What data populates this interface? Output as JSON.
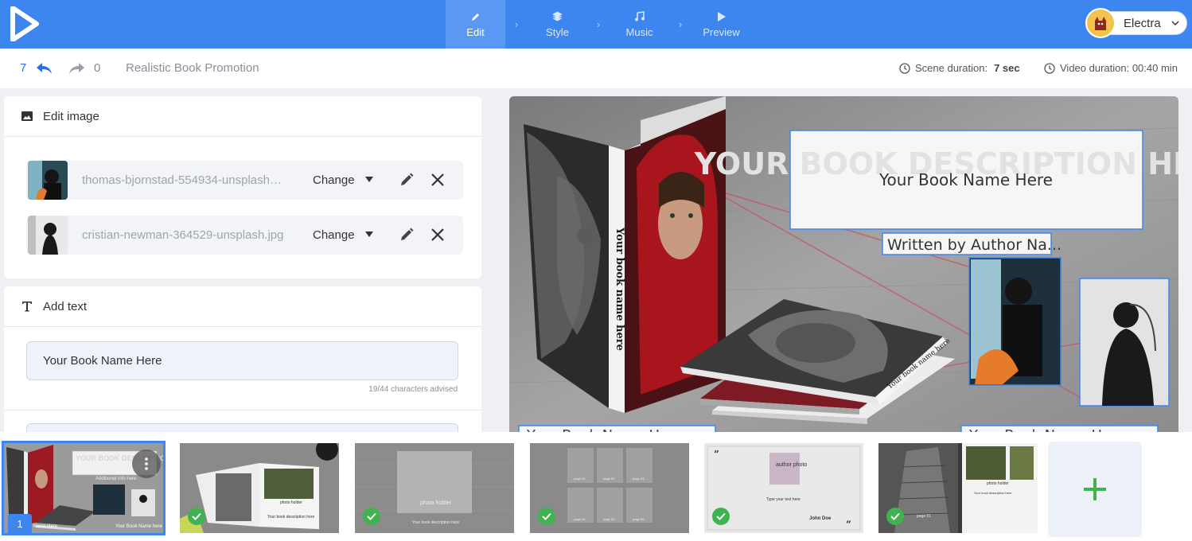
{
  "nav": {
    "steps": [
      {
        "label": "Edit",
        "icon": "pencil-icon",
        "active": true
      },
      {
        "label": "Style",
        "icon": "layers-icon",
        "active": false
      },
      {
        "label": "Music",
        "icon": "music-note-icon",
        "active": false
      },
      {
        "label": "Preview",
        "icon": "play-icon",
        "active": false
      }
    ],
    "user_name": "Electra"
  },
  "toolbar": {
    "undo_count": "7",
    "redo_count": "0",
    "project_title": "Realistic Book Promotion",
    "scene_duration_label": "Scene duration:",
    "scene_duration_value": "7 sec",
    "video_duration": "Video duration: 00:40 min"
  },
  "edit_image": {
    "title": "Edit image",
    "images": [
      {
        "name": "thomas-bjornstad-554934-unsplash.jpg",
        "change_label": "Change"
      },
      {
        "name": "cristian-newman-364529-unsplash.jpg",
        "change_label": "Change"
      }
    ]
  },
  "add_text": {
    "title": "Add text",
    "field_value": "Your Book Name Here",
    "char_hint": "19/44 characters advised"
  },
  "preview": {
    "description_text": "YOUR BOOK DESCRIPTION HERE",
    "book_name": "Your Book Name Here",
    "author": "Written by Author Na...",
    "spine_text": "Your book name here",
    "spine_text_2": "Your book name here",
    "bottom_left_name": "Your Book Name Here",
    "bottom_right_name": "Your Book Name Here"
  },
  "timeline": {
    "scene_1": {
      "number": "1",
      "description": "YOUR BOOK DESCRIPTION HERE",
      "info": "Additional info here",
      "name_left": "Your book Name Here",
      "name_right": "Your Book Name here"
    },
    "scene_2": {
      "photo_holder": "photo holder",
      "description": "Your book description here"
    },
    "scene_3": {
      "photo_holder": "photo holder",
      "description": "Your book description here"
    },
    "scene_4": {
      "pages": [
        "page 01",
        "page 02",
        "page 03",
        "page 04",
        "page 05",
        "page 06"
      ]
    },
    "scene_5": {
      "author_photo": "author photo",
      "text": "Type your text here",
      "author": "John Doe"
    },
    "scene_6": {
      "photo_holder": "photo holder",
      "page": "page 01",
      "description": "Your book description here"
    }
  },
  "colors": {
    "brand_blue": "#3d86f0",
    "check_green": "#3fb34f",
    "add_plus_green": "#3fb34f"
  }
}
